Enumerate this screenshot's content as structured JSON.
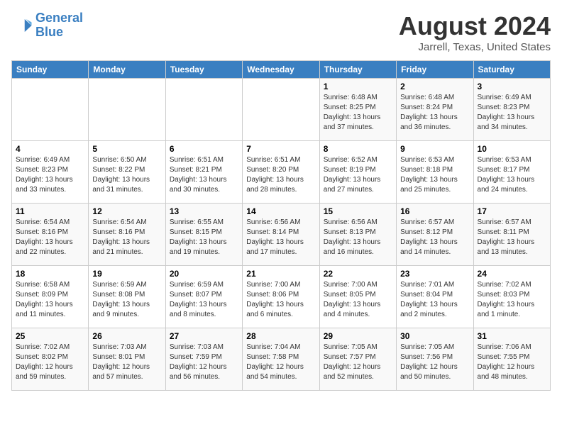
{
  "header": {
    "logo_line1": "General",
    "logo_line2": "Blue",
    "title": "August 2024",
    "subtitle": "Jarrell, Texas, United States"
  },
  "days_of_week": [
    "Sunday",
    "Monday",
    "Tuesday",
    "Wednesday",
    "Thursday",
    "Friday",
    "Saturday"
  ],
  "weeks": [
    [
      {
        "day": "",
        "info": ""
      },
      {
        "day": "",
        "info": ""
      },
      {
        "day": "",
        "info": ""
      },
      {
        "day": "",
        "info": ""
      },
      {
        "day": "1",
        "info": "Sunrise: 6:48 AM\nSunset: 8:25 PM\nDaylight: 13 hours\nand 37 minutes."
      },
      {
        "day": "2",
        "info": "Sunrise: 6:48 AM\nSunset: 8:24 PM\nDaylight: 13 hours\nand 36 minutes."
      },
      {
        "day": "3",
        "info": "Sunrise: 6:49 AM\nSunset: 8:23 PM\nDaylight: 13 hours\nand 34 minutes."
      }
    ],
    [
      {
        "day": "4",
        "info": "Sunrise: 6:49 AM\nSunset: 8:23 PM\nDaylight: 13 hours\nand 33 minutes."
      },
      {
        "day": "5",
        "info": "Sunrise: 6:50 AM\nSunset: 8:22 PM\nDaylight: 13 hours\nand 31 minutes."
      },
      {
        "day": "6",
        "info": "Sunrise: 6:51 AM\nSunset: 8:21 PM\nDaylight: 13 hours\nand 30 minutes."
      },
      {
        "day": "7",
        "info": "Sunrise: 6:51 AM\nSunset: 8:20 PM\nDaylight: 13 hours\nand 28 minutes."
      },
      {
        "day": "8",
        "info": "Sunrise: 6:52 AM\nSunset: 8:19 PM\nDaylight: 13 hours\nand 27 minutes."
      },
      {
        "day": "9",
        "info": "Sunrise: 6:53 AM\nSunset: 8:18 PM\nDaylight: 13 hours\nand 25 minutes."
      },
      {
        "day": "10",
        "info": "Sunrise: 6:53 AM\nSunset: 8:17 PM\nDaylight: 13 hours\nand 24 minutes."
      }
    ],
    [
      {
        "day": "11",
        "info": "Sunrise: 6:54 AM\nSunset: 8:16 PM\nDaylight: 13 hours\nand 22 minutes."
      },
      {
        "day": "12",
        "info": "Sunrise: 6:54 AM\nSunset: 8:16 PM\nDaylight: 13 hours\nand 21 minutes."
      },
      {
        "day": "13",
        "info": "Sunrise: 6:55 AM\nSunset: 8:15 PM\nDaylight: 13 hours\nand 19 minutes."
      },
      {
        "day": "14",
        "info": "Sunrise: 6:56 AM\nSunset: 8:14 PM\nDaylight: 13 hours\nand 17 minutes."
      },
      {
        "day": "15",
        "info": "Sunrise: 6:56 AM\nSunset: 8:13 PM\nDaylight: 13 hours\nand 16 minutes."
      },
      {
        "day": "16",
        "info": "Sunrise: 6:57 AM\nSunset: 8:12 PM\nDaylight: 13 hours\nand 14 minutes."
      },
      {
        "day": "17",
        "info": "Sunrise: 6:57 AM\nSunset: 8:11 PM\nDaylight: 13 hours\nand 13 minutes."
      }
    ],
    [
      {
        "day": "18",
        "info": "Sunrise: 6:58 AM\nSunset: 8:09 PM\nDaylight: 13 hours\nand 11 minutes."
      },
      {
        "day": "19",
        "info": "Sunrise: 6:59 AM\nSunset: 8:08 PM\nDaylight: 13 hours\nand 9 minutes."
      },
      {
        "day": "20",
        "info": "Sunrise: 6:59 AM\nSunset: 8:07 PM\nDaylight: 13 hours\nand 8 minutes."
      },
      {
        "day": "21",
        "info": "Sunrise: 7:00 AM\nSunset: 8:06 PM\nDaylight: 13 hours\nand 6 minutes."
      },
      {
        "day": "22",
        "info": "Sunrise: 7:00 AM\nSunset: 8:05 PM\nDaylight: 13 hours\nand 4 minutes."
      },
      {
        "day": "23",
        "info": "Sunrise: 7:01 AM\nSunset: 8:04 PM\nDaylight: 13 hours\nand 2 minutes."
      },
      {
        "day": "24",
        "info": "Sunrise: 7:02 AM\nSunset: 8:03 PM\nDaylight: 13 hours\nand 1 minute."
      }
    ],
    [
      {
        "day": "25",
        "info": "Sunrise: 7:02 AM\nSunset: 8:02 PM\nDaylight: 12 hours\nand 59 minutes."
      },
      {
        "day": "26",
        "info": "Sunrise: 7:03 AM\nSunset: 8:01 PM\nDaylight: 12 hours\nand 57 minutes."
      },
      {
        "day": "27",
        "info": "Sunrise: 7:03 AM\nSunset: 7:59 PM\nDaylight: 12 hours\nand 56 minutes."
      },
      {
        "day": "28",
        "info": "Sunrise: 7:04 AM\nSunset: 7:58 PM\nDaylight: 12 hours\nand 54 minutes."
      },
      {
        "day": "29",
        "info": "Sunrise: 7:05 AM\nSunset: 7:57 PM\nDaylight: 12 hours\nand 52 minutes."
      },
      {
        "day": "30",
        "info": "Sunrise: 7:05 AM\nSunset: 7:56 PM\nDaylight: 12 hours\nand 50 minutes."
      },
      {
        "day": "31",
        "info": "Sunrise: 7:06 AM\nSunset: 7:55 PM\nDaylight: 12 hours\nand 48 minutes."
      }
    ]
  ]
}
